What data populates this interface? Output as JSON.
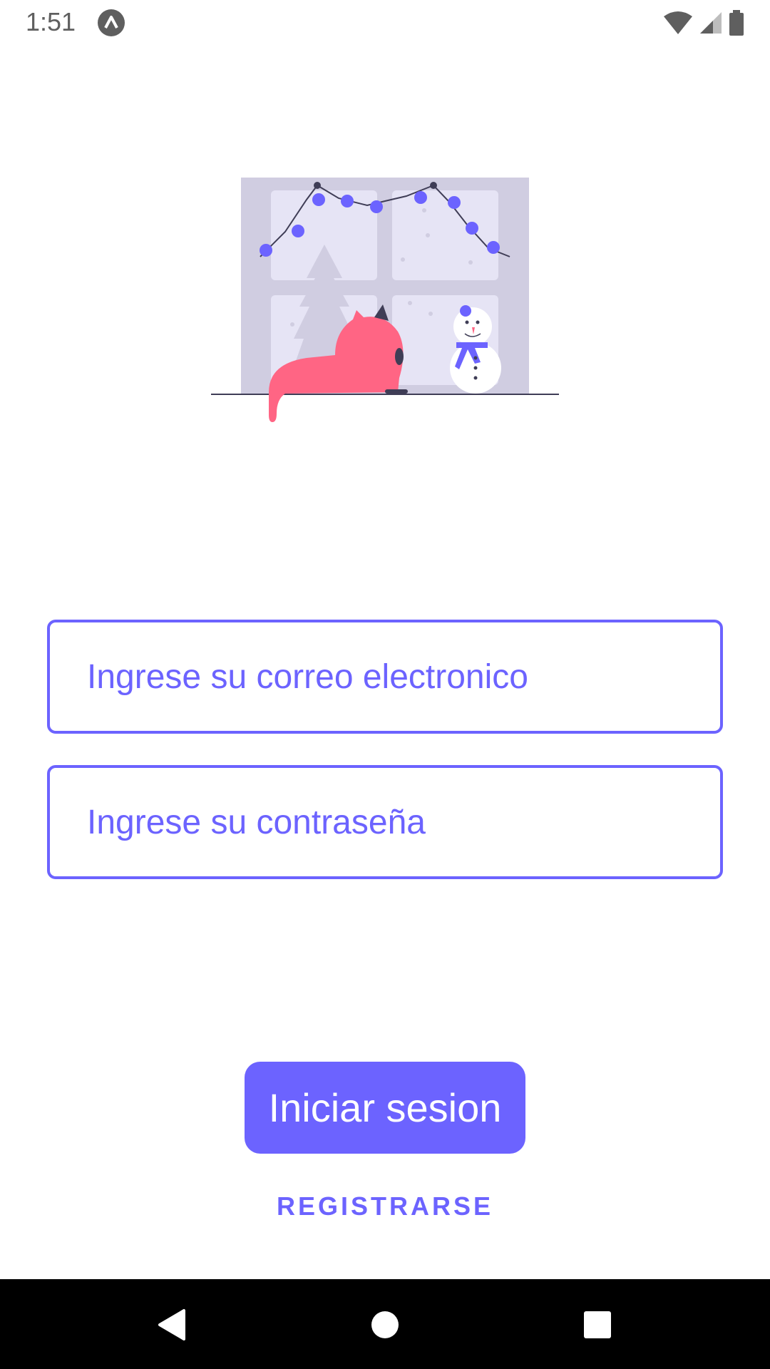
{
  "status_bar": {
    "time": "1:51",
    "app_icon": "a-circle-icon",
    "wifi_icon": "wifi-icon",
    "signal_icon": "signal-icon",
    "battery_icon": "battery-icon"
  },
  "illustration": {
    "name": "cat-window-snowman-illustration"
  },
  "form": {
    "email_placeholder": "Ingrese su correo electronico",
    "email_value": "",
    "password_placeholder": "Ingrese su contraseña",
    "password_value": ""
  },
  "actions": {
    "login_label": "Iniciar sesion",
    "register_label": "REGISTRARSE"
  },
  "nav_bar": {
    "back_icon": "back-triangle-icon",
    "home_icon": "home-circle-icon",
    "recents_icon": "recents-square-icon"
  },
  "colors": {
    "accent": "#6c63ff",
    "cat": "#ff6584",
    "window_frame": "#d0cde1",
    "window_pane": "#e6e4f5"
  }
}
